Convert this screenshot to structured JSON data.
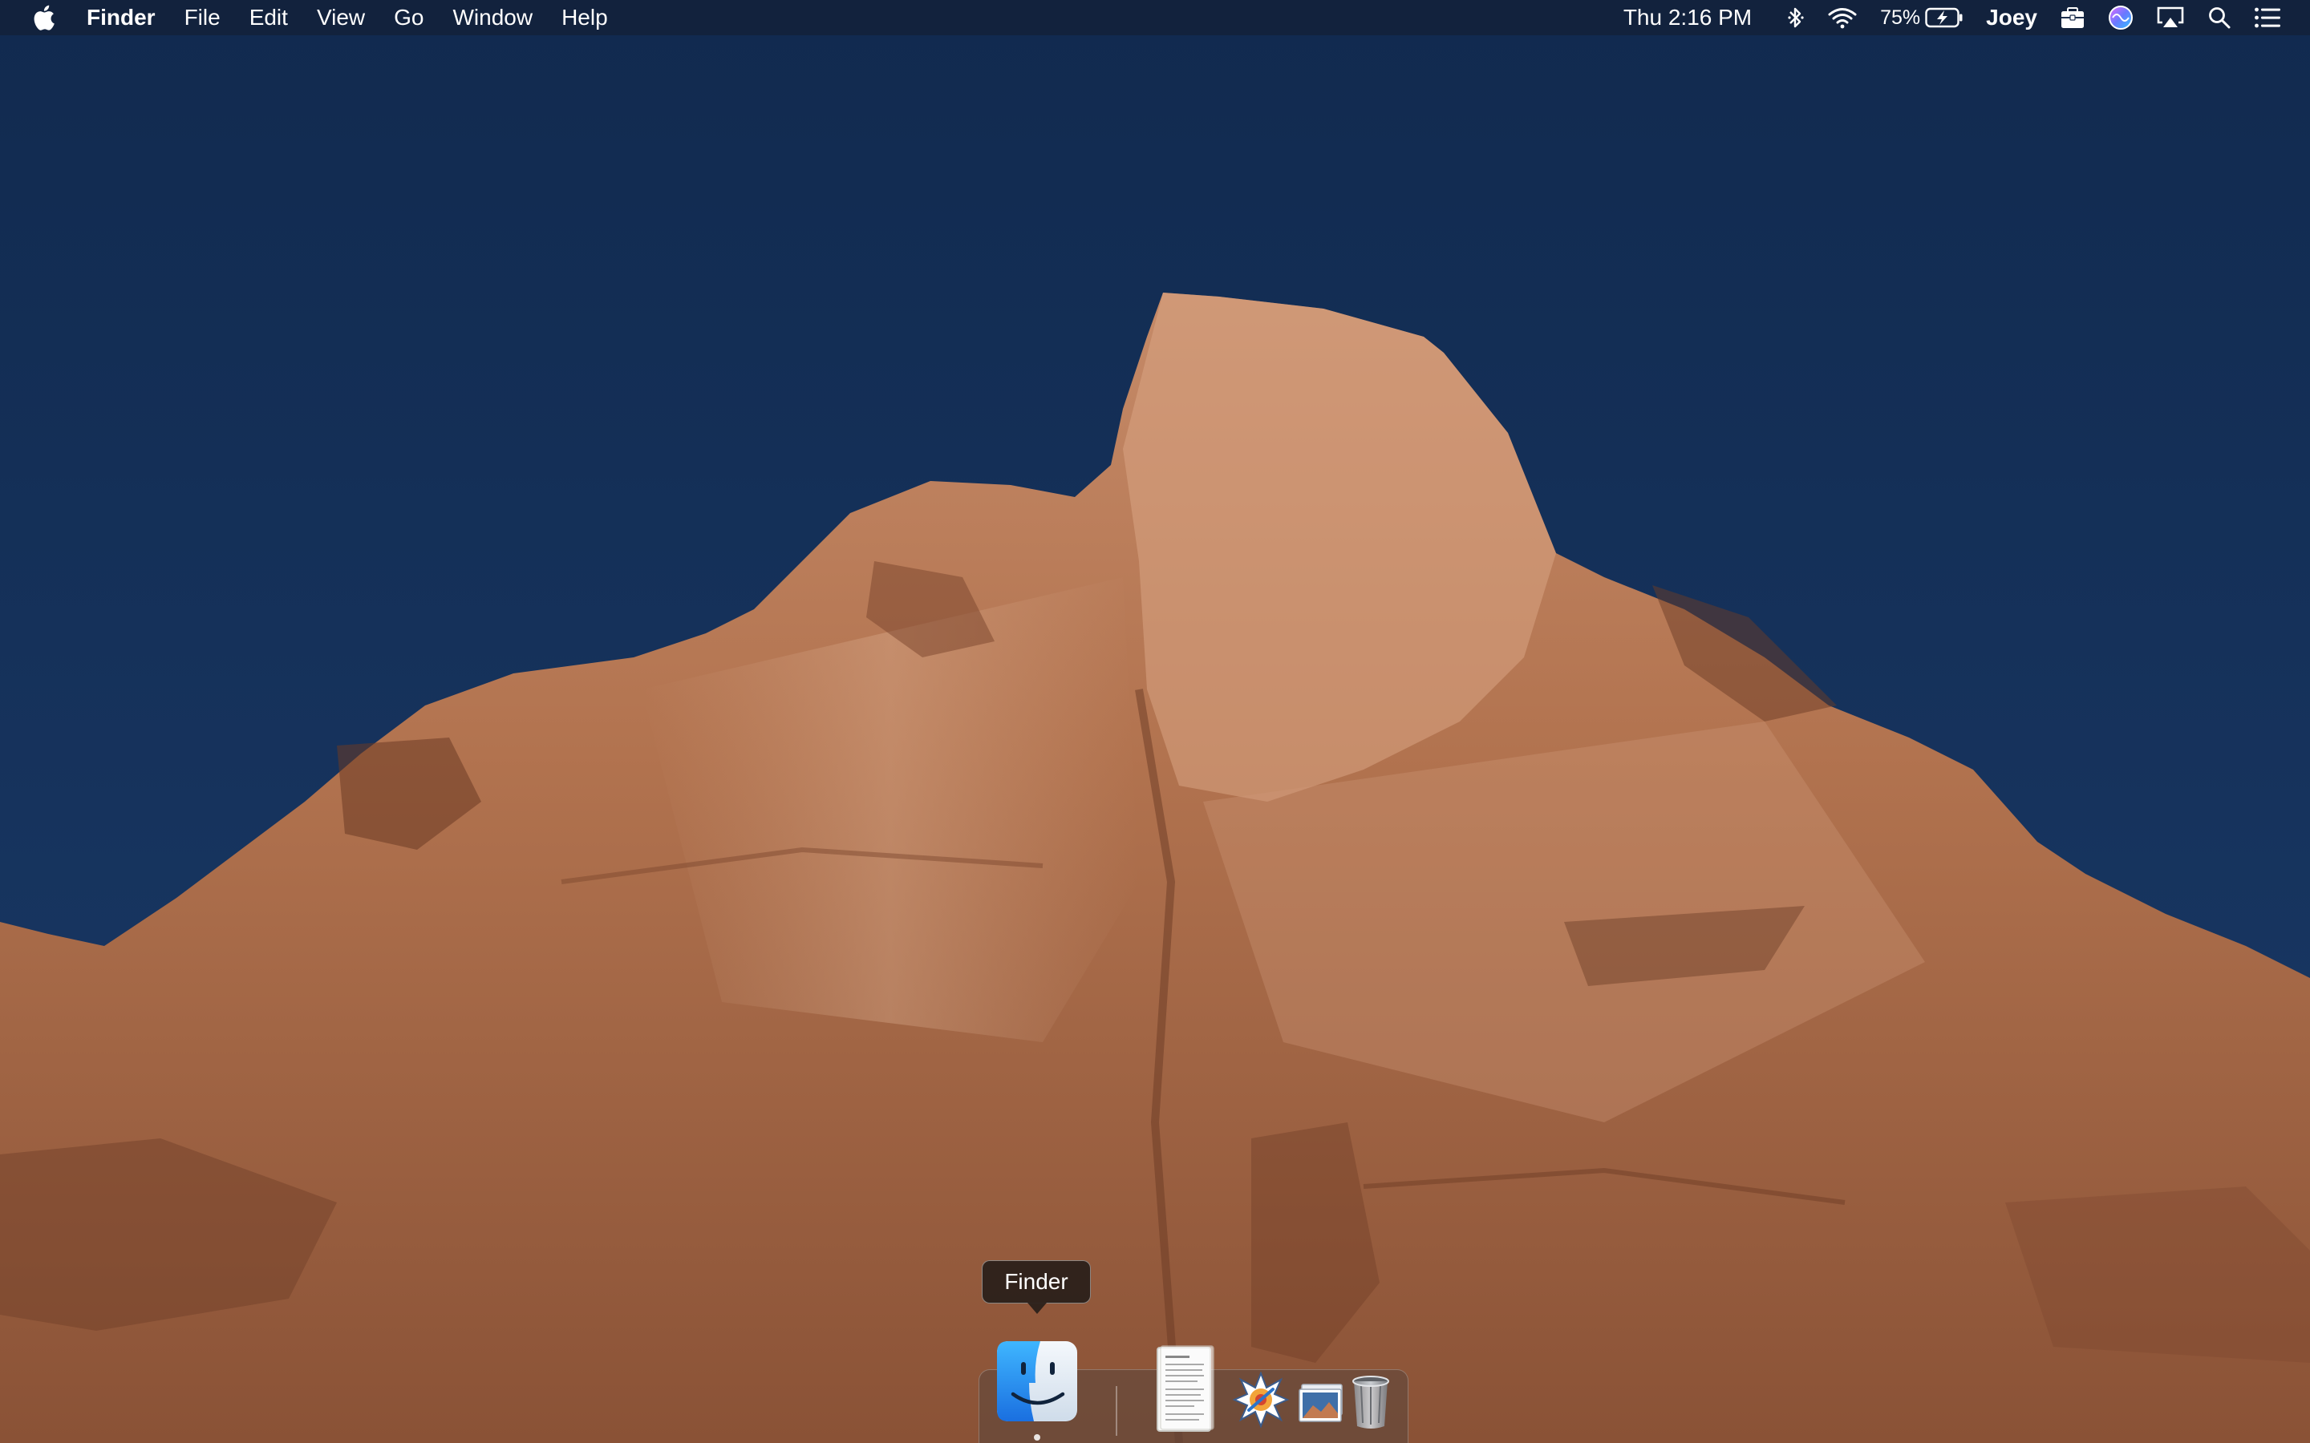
{
  "menubar": {
    "apple_icon": "apple-logo-icon",
    "app_name": "Finder",
    "menus": [
      "File",
      "Edit",
      "View",
      "Go",
      "Window",
      "Help"
    ],
    "clock": "Thu 2:16 PM",
    "battery_percent": "75%",
    "user_name": "Joey",
    "status_icons": [
      "bluetooth-icon",
      "wifi-icon",
      "battery-charging-icon",
      "toolbox-icon",
      "siri-icon",
      "airplay-icon",
      "search-icon",
      "notification-center-icon"
    ]
  },
  "dock": {
    "tooltip": "Finder",
    "apps": [
      {
        "name": "Finder",
        "icon": "finder-icon",
        "running": true
      },
      {
        "name": "Document",
        "icon": "document-icon",
        "running": false
      },
      {
        "name": "Preview",
        "icon": "preview-icon",
        "running": false
      },
      {
        "name": "Photos",
        "icon": "photo-stack-icon",
        "running": false
      },
      {
        "name": "Trash",
        "icon": "trash-icon",
        "running": false
      }
    ]
  },
  "colors": {
    "sky": "#16325a",
    "rock": "#a8694a",
    "menubar_bg": "#12223c"
  }
}
